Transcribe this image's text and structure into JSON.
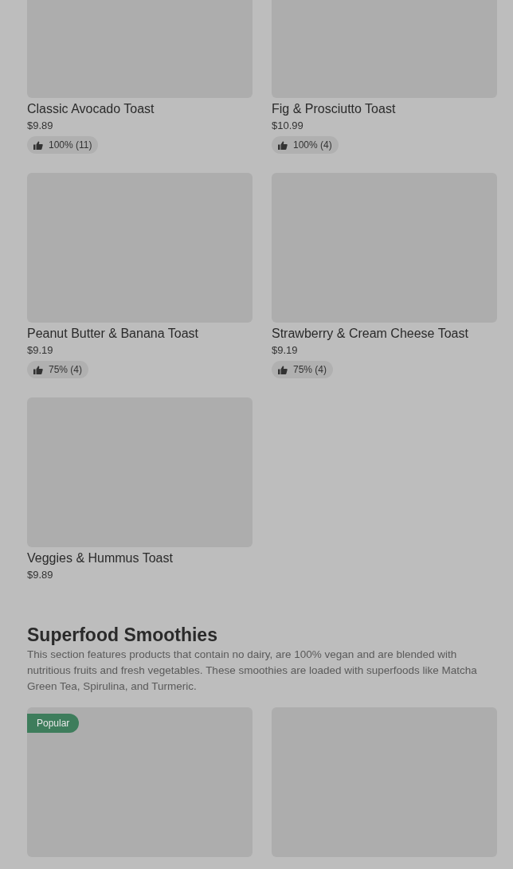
{
  "sections": [
    {
      "products": [
        {
          "kind": "product",
          "name": "Classic Avocado Toast",
          "price": "$9.89",
          "rating": "100% (11)"
        },
        {
          "kind": "product",
          "name": "Fig & Prosciutto Toast",
          "price": "$10.99",
          "rating": "100% (4)"
        },
        {
          "kind": "product",
          "name": "Peanut Butter & Banana Toast",
          "price": "$9.19",
          "rating": "75% (4)"
        },
        {
          "kind": "product",
          "name": "Strawberry & Cream Cheese Toast",
          "price": "$9.19",
          "rating": "75% (4)"
        },
        {
          "kind": "product",
          "name": "Veggies & Hummus Toast",
          "price": "$9.89"
        }
      ]
    },
    {
      "title": "Superfood Smoothies",
      "description": "This section features products that contain no dairy, are 100% vegan and are blended with nutritious fruits and fresh vegetables. These smoothies are loaded with superfoods like Matcha Green Tea, Spirulina, and Turmeric.",
      "products": [
        {
          "kind": "product",
          "badge": "Popular"
        },
        {
          "kind": "product"
        }
      ]
    }
  ]
}
